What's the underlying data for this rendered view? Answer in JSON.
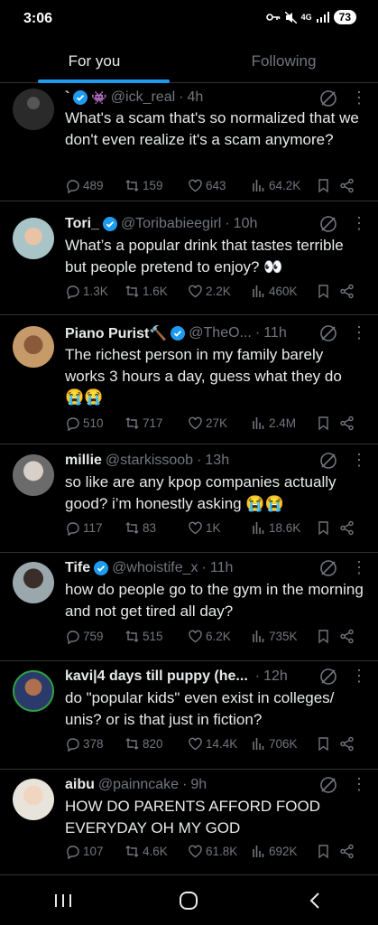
{
  "status_bar": {
    "time": "3:06",
    "battery": "73",
    "network": "4G"
  },
  "tabs": [
    {
      "label": "For you",
      "active": true
    },
    {
      "label": "Following",
      "active": false
    }
  ],
  "posts": [
    {
      "name": "`",
      "name_extra": "👾",
      "verified": true,
      "handle": "@ick_real",
      "time": "4h",
      "text": "What's a scam that's so normalized that we don't even realize it's a scam anymore?",
      "replies": "489",
      "reposts": "159",
      "likes": "643",
      "views": "64.2K"
    },
    {
      "name": "Tori_",
      "verified": true,
      "handle": "@Toribabieegirl",
      "time": "10h",
      "text": "What’s a popular drink that tastes terrible but people pretend to enjoy? 👀",
      "replies": "1.3K",
      "reposts": "1.6K",
      "likes": "2.2K",
      "views": "460K"
    },
    {
      "name": "Piano Purist🔨",
      "verified": true,
      "handle": "@TheO...",
      "time": "11h",
      "text": "The richest person in my family barely works 3 hours a day, guess what they do 😭😭",
      "replies": "510",
      "reposts": "717",
      "likes": "27K",
      "views": "2.4M"
    },
    {
      "name": "millie",
      "verified": false,
      "handle": "@starkissoob",
      "time": "13h",
      "text": "so like are any kpop companies actually good? i’m honestly asking 😭😭",
      "replies": "117",
      "reposts": "83",
      "likes": "1K",
      "views": "18.6K"
    },
    {
      "name": "Tife",
      "verified": true,
      "handle": "@whoistife_x",
      "time": "11h",
      "text": "how do people go to the gym in the morning and not get tired all day?",
      "replies": "759",
      "reposts": "515",
      "likes": "6.2K",
      "views": "735K"
    },
    {
      "name": "kavi|4 days till puppy (he...",
      "verified": false,
      "handle": "",
      "time": "12h",
      "text": "do \"popular kids\" even exist in colleges/ unis? or is that just in fiction?",
      "replies": "378",
      "reposts": "820",
      "likes": "14.4K",
      "views": "706K"
    },
    {
      "name": "aibu",
      "verified": false,
      "handle": "@painncake",
      "time": "9h",
      "text": "HOW DO PARENTS AFFORD FOOD EVERYDAY OH MY GOD",
      "replies": "107",
      "reposts": "4.6K",
      "likes": "61.8K",
      "views": "692K"
    }
  ],
  "colors": {
    "accent": "#1d9bf0",
    "background": "#000000",
    "muted": "#71767b",
    "divider": "#2f3336"
  },
  "icons": {
    "reply": "reply-icon",
    "repost": "repost-icon",
    "like": "heart-icon",
    "views": "views-icon",
    "bookmark": "bookmark-icon",
    "share": "share-icon",
    "grok": "grok-icon"
  }
}
